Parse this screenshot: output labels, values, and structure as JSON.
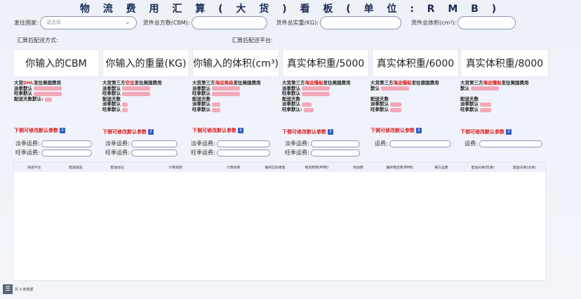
{
  "title": "物 流 费 用 汇 算 ( 大 货 ) 看 板 ( 单 位 : R M B )",
  "filters": {
    "country_label": "发往国家:",
    "country_placeholder": "请选择",
    "cbm_label": "货件总方数(CBM):",
    "weight_label": "货件总实重(KG):",
    "volume_label": "货件总体积(cm³):"
  },
  "row2": {
    "method_label": "汇算后配送方式:",
    "platform_label": "汇算后配送平台:"
  },
  "cards": [
    "你输入的CBM",
    "你输入的重量(KG)",
    "你输入的体积(cm³)",
    "真实体积重/5000",
    "真实体积重/6000",
    "真实体积重/8000"
  ],
  "columns": [
    {
      "prefix": "大货",
      "method": "DHL",
      "suffix": "发往美国费用",
      "lines": [
        "淡季默认",
        "旺季默认",
        "配送天数默认:"
      ]
    },
    {
      "prefix": "大货第三方",
      "method": "空运",
      "suffix": "发往美国费用",
      "lines": [
        "淡季默认",
        "旺季默认",
        "配送天数",
        "淡季默认",
        "旺季默认"
      ]
    },
    {
      "prefix": "大货第三方",
      "method": "海运美森",
      "suffix": "发往美国费用",
      "lines": [
        "淡季默认",
        "旺季默认",
        "配送天数",
        "淡季默认",
        "旺季默认"
      ]
    },
    {
      "prefix": "大货第三方",
      "method": "海运慢船",
      "suffix": "发往美国费用",
      "lines": [
        "淡季默认",
        "旺季默认",
        "配送天数",
        "淡季默认",
        "旺季默认:"
      ]
    },
    {
      "prefix": "大货第三方",
      "method": "海运慢船",
      "suffix": "发往德国费用",
      "lines": [
        "默认",
        "",
        "配送天数",
        "淡季默认",
        "旺季默认"
      ]
    },
    {
      "prefix": "大货第三方",
      "method": "海运慢船",
      "suffix": "发往美国费用",
      "lines": [
        "默认",
        "",
        "配送天数",
        "淡季默认",
        "旺季默认"
      ]
    }
  ],
  "modify_label": "下侧可修改默认参数",
  "info_icon": "i",
  "fees": {
    "off_peak": "淡季运费:",
    "peak": "旺季运费:",
    "fee": "运费:"
  },
  "table_headers": [
    "快递平台",
    "配送渠道",
    "配送地址",
    "计费规则",
    "计费规则",
    "最终实际重量",
    "物流费用(RMB)",
    "附加费",
    "最终物流费(RMB)",
    "每方运费",
    "配送天数(旺季)",
    "配送天数(淡季)"
  ],
  "footer": {
    "text": "共 0 条数据",
    "count": "0"
  }
}
